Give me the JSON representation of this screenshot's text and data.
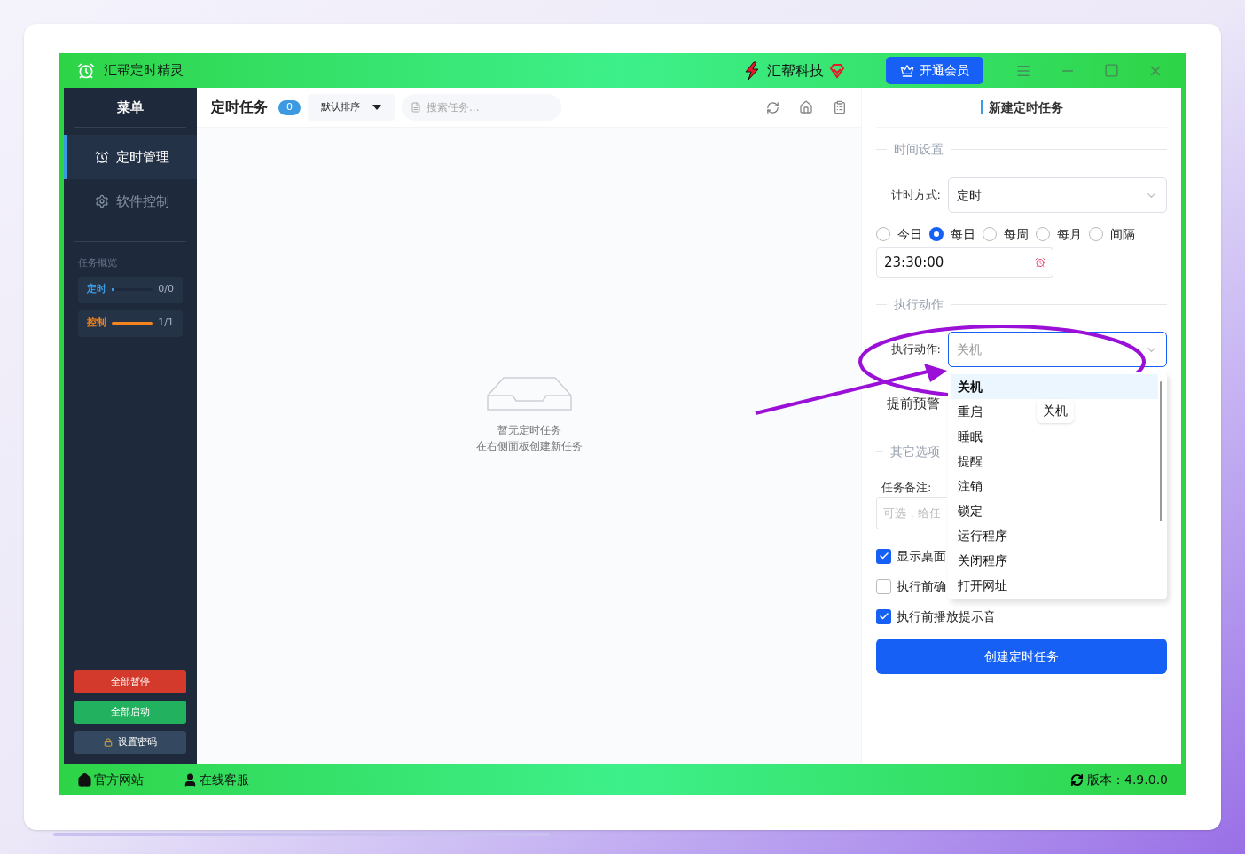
{
  "app": {
    "title": "汇帮定时精灵",
    "brand": "汇帮科技",
    "vip_button": "开通会员"
  },
  "sidebar": {
    "title": "菜单",
    "items": [
      {
        "label": "定时管理",
        "kind": "clock",
        "selected": true
      },
      {
        "label": "软件控制",
        "kind": "gear",
        "selected": false
      }
    ],
    "overview_title": "任务概览",
    "stats": [
      {
        "label": "定时",
        "count": "0/0",
        "level": 0,
        "color": "#3b9ae1"
      },
      {
        "label": "控制",
        "count": "1/1",
        "level": 1,
        "color": "#f5841f"
      }
    ],
    "buttons": [
      {
        "label": "全部暂停",
        "kind": "danger"
      },
      {
        "label": "全部启动",
        "kind": "success"
      },
      {
        "label": "设置密码",
        "kind": "lock"
      }
    ]
  },
  "tasks": {
    "title": "定时任务",
    "count": "0",
    "sort": "默认排序",
    "search_placeholder": "搜索任务...",
    "empty_lines": [
      "暂无定时任务",
      "在右侧面板创建新任务"
    ]
  },
  "form": {
    "title": "新建定时任务",
    "time_section": "时间设置",
    "mode_label": "计时方式:",
    "mode_value": "定时",
    "radios": [
      {
        "label": "今日",
        "selected": false
      },
      {
        "label": "每日",
        "selected": true
      },
      {
        "label": "每周",
        "selected": false
      },
      {
        "label": "每月",
        "selected": false
      },
      {
        "label": "间隔",
        "selected": false
      }
    ],
    "time_value": "23:30:00",
    "action_section": "执行动作",
    "action_label": "执行动作:",
    "action_value": "关机",
    "action_options": [
      {
        "label": "关机",
        "selected": true
      },
      {
        "label": "重启",
        "selected": false
      },
      {
        "label": "睡眠",
        "selected": false
      },
      {
        "label": "提醒",
        "selected": false
      },
      {
        "label": "注销",
        "selected": false
      },
      {
        "label": "锁定",
        "selected": false
      },
      {
        "label": "运行程序",
        "selected": false
      },
      {
        "label": "关闭程序",
        "selected": false
      },
      {
        "label": "打开网址",
        "selected": false
      }
    ],
    "tooltip": "关机",
    "warn_label": "提前预警",
    "other_section": "其它选项",
    "note_label": "任务备注:",
    "note_placeholder": "可选，给任",
    "checkboxes": [
      {
        "label": "显示桌面",
        "checked": true
      },
      {
        "label": "执行前确",
        "checked": false
      },
      {
        "label": "执行前播放提示音",
        "checked": true
      }
    ],
    "submit": "创建定时任务"
  },
  "footer": {
    "links": [
      {
        "label": "官方网站",
        "kind": "home"
      },
      {
        "label": "在线客服",
        "kind": "support"
      }
    ],
    "version": "版本：4.9.0.0"
  }
}
